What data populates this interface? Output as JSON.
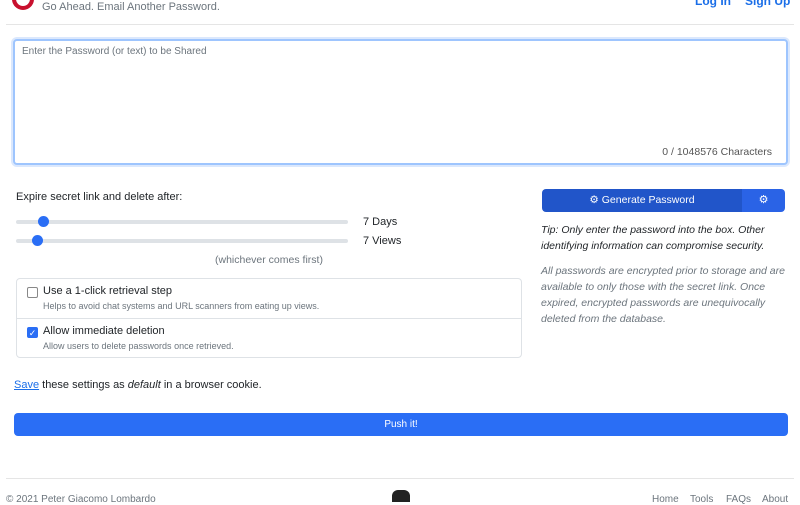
{
  "header": {
    "tagline": "Go Ahead. Email Another Password.",
    "login": "Log In",
    "signup": "Sign Up"
  },
  "input": {
    "placeholder": "Enter the Password (or text) to be Shared",
    "count": "0 / 1048576 Characters"
  },
  "expire": {
    "label": "Expire secret link and delete after:",
    "days_value": "7 Days",
    "views_value": "7 Views",
    "days_fraction": 0.07,
    "views_fraction": 0.05,
    "note": "(whichever comes first)"
  },
  "options": [
    {
      "title": "Use a 1-click retrieval step",
      "desc": "Helps to avoid chat systems and URL scanners from eating up views.",
      "checked": false
    },
    {
      "title": "Allow immediate deletion",
      "desc": "Allow users to delete passwords once retrieved.",
      "checked": true
    }
  ],
  "generate": {
    "label": "Generate Password",
    "icon": "gear-icon"
  },
  "tip": "Tip: Only enter the password into the box. Other identifying information can compromise security.",
  "info": "All passwords are encrypted prior to storage and are available to only those with the secret link. Once expired, encrypted passwords are unequivocally deleted from the database.",
  "save": {
    "link": "Save",
    "t1": " these settings as ",
    "em": "default",
    "t2": " in a browser cookie."
  },
  "push": "Push it!",
  "footer": {
    "copyright": "© 2021 Peter Giacomo Lombardo",
    "links": [
      "Home",
      "Tools",
      "FAQs",
      "About"
    ]
  }
}
